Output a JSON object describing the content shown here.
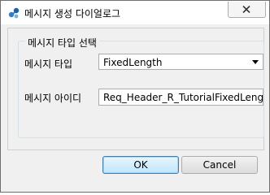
{
  "window": {
    "title": "메시지 생성 다이얼로그"
  },
  "group": {
    "legend": "메시지 타입 선택",
    "type_label": "메시지 타입",
    "type_value": "FixedLength",
    "id_label": "메시지 아이디",
    "id_value": "Req_Header_R_TutorialFixedLength"
  },
  "buttons": {
    "ok": "OK",
    "cancel": "Cancel"
  },
  "icons": {
    "app": "app-logo-icon",
    "close": "close-icon",
    "dropdown": "dropdown-arrow-icon"
  }
}
